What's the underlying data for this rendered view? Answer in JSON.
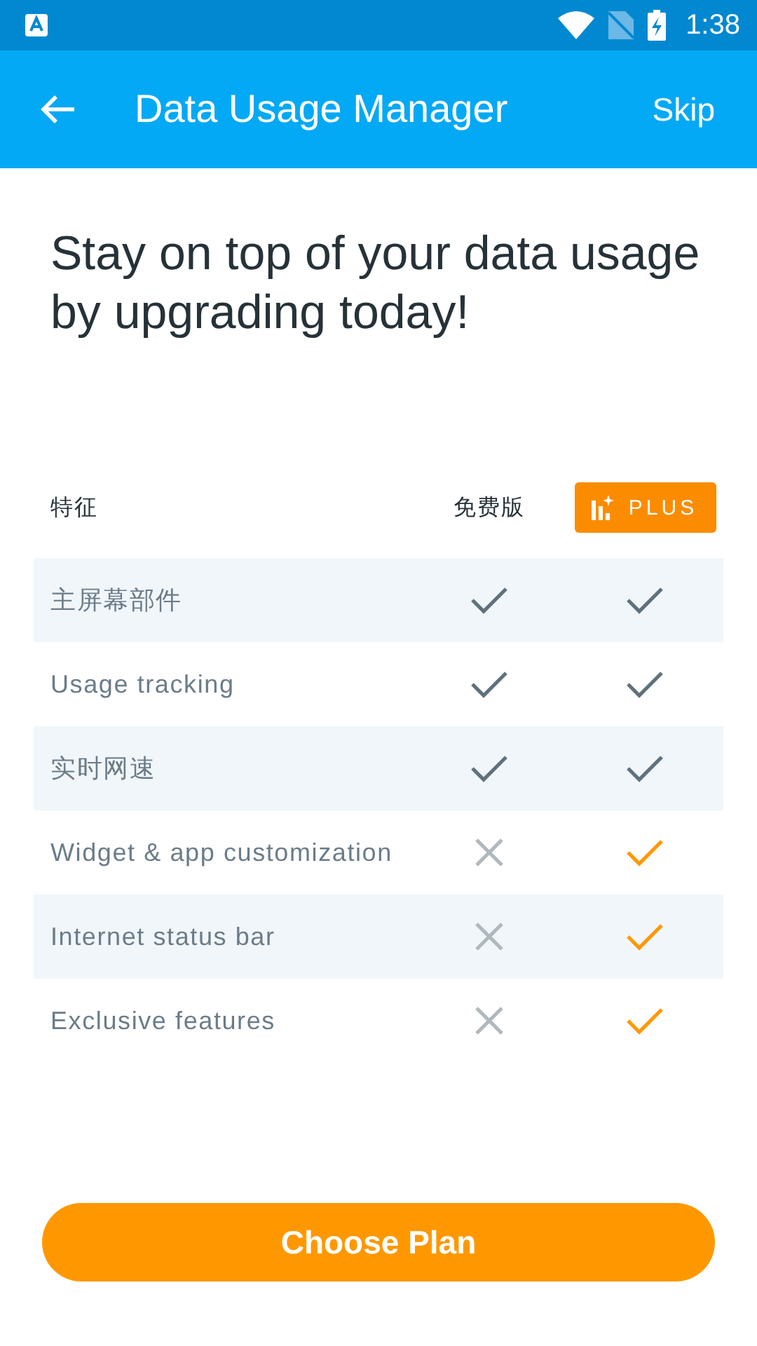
{
  "status_bar": {
    "time": "1:38"
  },
  "app_bar": {
    "title": "Data Usage Manager",
    "action": "Skip"
  },
  "headline": "Stay on top of your data usage by upgrading today!",
  "table": {
    "columns": [
      "特征",
      "免费版",
      "PLUS"
    ],
    "rows": [
      {
        "feature": "主屏幕部件",
        "free": true,
        "plus": true
      },
      {
        "feature": "Usage tracking",
        "free": true,
        "plus": true
      },
      {
        "feature": "实时网速",
        "free": true,
        "plus": true
      },
      {
        "feature": "Widget & app customization",
        "free": false,
        "plus": true
      },
      {
        "feature": "Internet status bar",
        "free": false,
        "plus": true
      },
      {
        "feature": "Exclusive features",
        "free": false,
        "plus": true
      }
    ]
  },
  "cta": "Choose Plan"
}
